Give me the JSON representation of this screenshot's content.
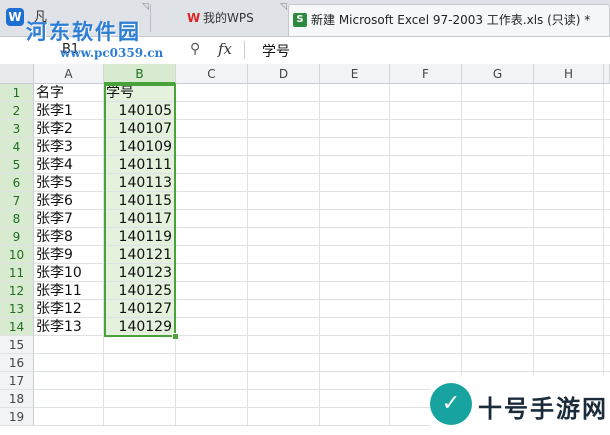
{
  "tabs": {
    "home_label": "凡",
    "wps_label": "我的WPS",
    "file_title": "新建 Microsoft Excel 97-2003 工作表.xls (只读) *"
  },
  "watermark": {
    "site_name": "河东软件园",
    "site_url": "www.pc0359.cn"
  },
  "formula_bar": {
    "cell_ref": "B1",
    "fx_label": "fx",
    "value": "学号"
  },
  "columns": [
    "A",
    "B",
    "C",
    "D",
    "E",
    "F",
    "G",
    "H"
  ],
  "selected_column": "B",
  "rows": [
    "1",
    "2",
    "3",
    "4",
    "5",
    "6",
    "7",
    "8",
    "9",
    "10",
    "11",
    "12",
    "13",
    "14",
    "15",
    "16",
    "17",
    "18",
    "19"
  ],
  "table": {
    "headers": [
      "名字",
      "学号"
    ],
    "data": [
      [
        "张李1",
        "140105"
      ],
      [
        "张李2",
        "140107"
      ],
      [
        "张李3",
        "140109"
      ],
      [
        "张李4",
        "140111"
      ],
      [
        "张李5",
        "140113"
      ],
      [
        "张李6",
        "140115"
      ],
      [
        "张李7",
        "140117"
      ],
      [
        "张李8",
        "140119"
      ],
      [
        "张李9",
        "140121"
      ],
      [
        "张李10",
        "140123"
      ],
      [
        "张李11",
        "140125"
      ],
      [
        "张李12",
        "140127"
      ],
      [
        "张李13",
        "140129"
      ]
    ]
  },
  "brand": {
    "name": "十号手游网"
  },
  "colors": {
    "selection": "#4aa23a",
    "selection_fill": "#e4f1dc",
    "header_bg": "#f1f3f5"
  }
}
